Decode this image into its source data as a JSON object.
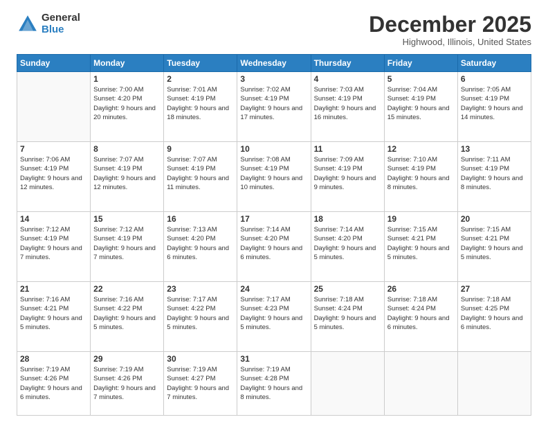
{
  "logo": {
    "general": "General",
    "blue": "Blue"
  },
  "header": {
    "month": "December 2025",
    "location": "Highwood, Illinois, United States"
  },
  "weekdays": [
    "Sunday",
    "Monday",
    "Tuesday",
    "Wednesday",
    "Thursday",
    "Friday",
    "Saturday"
  ],
  "weeks": [
    [
      {
        "day": "",
        "sunrise": "",
        "sunset": "",
        "daylight": ""
      },
      {
        "day": "1",
        "sunrise": "Sunrise: 7:00 AM",
        "sunset": "Sunset: 4:20 PM",
        "daylight": "Daylight: 9 hours and 20 minutes."
      },
      {
        "day": "2",
        "sunrise": "Sunrise: 7:01 AM",
        "sunset": "Sunset: 4:19 PM",
        "daylight": "Daylight: 9 hours and 18 minutes."
      },
      {
        "day": "3",
        "sunrise": "Sunrise: 7:02 AM",
        "sunset": "Sunset: 4:19 PM",
        "daylight": "Daylight: 9 hours and 17 minutes."
      },
      {
        "day": "4",
        "sunrise": "Sunrise: 7:03 AM",
        "sunset": "Sunset: 4:19 PM",
        "daylight": "Daylight: 9 hours and 16 minutes."
      },
      {
        "day": "5",
        "sunrise": "Sunrise: 7:04 AM",
        "sunset": "Sunset: 4:19 PM",
        "daylight": "Daylight: 9 hours and 15 minutes."
      },
      {
        "day": "6",
        "sunrise": "Sunrise: 7:05 AM",
        "sunset": "Sunset: 4:19 PM",
        "daylight": "Daylight: 9 hours and 14 minutes."
      }
    ],
    [
      {
        "day": "7",
        "sunrise": "Sunrise: 7:06 AM",
        "sunset": "Sunset: 4:19 PM",
        "daylight": "Daylight: 9 hours and 12 minutes."
      },
      {
        "day": "8",
        "sunrise": "Sunrise: 7:07 AM",
        "sunset": "Sunset: 4:19 PM",
        "daylight": "Daylight: 9 hours and 12 minutes."
      },
      {
        "day": "9",
        "sunrise": "Sunrise: 7:07 AM",
        "sunset": "Sunset: 4:19 PM",
        "daylight": "Daylight: 9 hours and 11 minutes."
      },
      {
        "day": "10",
        "sunrise": "Sunrise: 7:08 AM",
        "sunset": "Sunset: 4:19 PM",
        "daylight": "Daylight: 9 hours and 10 minutes."
      },
      {
        "day": "11",
        "sunrise": "Sunrise: 7:09 AM",
        "sunset": "Sunset: 4:19 PM",
        "daylight": "Daylight: 9 hours and 9 minutes."
      },
      {
        "day": "12",
        "sunrise": "Sunrise: 7:10 AM",
        "sunset": "Sunset: 4:19 PM",
        "daylight": "Daylight: 9 hours and 8 minutes."
      },
      {
        "day": "13",
        "sunrise": "Sunrise: 7:11 AM",
        "sunset": "Sunset: 4:19 PM",
        "daylight": "Daylight: 9 hours and 8 minutes."
      }
    ],
    [
      {
        "day": "14",
        "sunrise": "Sunrise: 7:12 AM",
        "sunset": "Sunset: 4:19 PM",
        "daylight": "Daylight: 9 hours and 7 minutes."
      },
      {
        "day": "15",
        "sunrise": "Sunrise: 7:12 AM",
        "sunset": "Sunset: 4:19 PM",
        "daylight": "Daylight: 9 hours and 7 minutes."
      },
      {
        "day": "16",
        "sunrise": "Sunrise: 7:13 AM",
        "sunset": "Sunset: 4:20 PM",
        "daylight": "Daylight: 9 hours and 6 minutes."
      },
      {
        "day": "17",
        "sunrise": "Sunrise: 7:14 AM",
        "sunset": "Sunset: 4:20 PM",
        "daylight": "Daylight: 9 hours and 6 minutes."
      },
      {
        "day": "18",
        "sunrise": "Sunrise: 7:14 AM",
        "sunset": "Sunset: 4:20 PM",
        "daylight": "Daylight: 9 hours and 5 minutes."
      },
      {
        "day": "19",
        "sunrise": "Sunrise: 7:15 AM",
        "sunset": "Sunset: 4:21 PM",
        "daylight": "Daylight: 9 hours and 5 minutes."
      },
      {
        "day": "20",
        "sunrise": "Sunrise: 7:15 AM",
        "sunset": "Sunset: 4:21 PM",
        "daylight": "Daylight: 9 hours and 5 minutes."
      }
    ],
    [
      {
        "day": "21",
        "sunrise": "Sunrise: 7:16 AM",
        "sunset": "Sunset: 4:21 PM",
        "daylight": "Daylight: 9 hours and 5 minutes."
      },
      {
        "day": "22",
        "sunrise": "Sunrise: 7:16 AM",
        "sunset": "Sunset: 4:22 PM",
        "daylight": "Daylight: 9 hours and 5 minutes."
      },
      {
        "day": "23",
        "sunrise": "Sunrise: 7:17 AM",
        "sunset": "Sunset: 4:22 PM",
        "daylight": "Daylight: 9 hours and 5 minutes."
      },
      {
        "day": "24",
        "sunrise": "Sunrise: 7:17 AM",
        "sunset": "Sunset: 4:23 PM",
        "daylight": "Daylight: 9 hours and 5 minutes."
      },
      {
        "day": "25",
        "sunrise": "Sunrise: 7:18 AM",
        "sunset": "Sunset: 4:24 PM",
        "daylight": "Daylight: 9 hours and 5 minutes."
      },
      {
        "day": "26",
        "sunrise": "Sunrise: 7:18 AM",
        "sunset": "Sunset: 4:24 PM",
        "daylight": "Daylight: 9 hours and 6 minutes."
      },
      {
        "day": "27",
        "sunrise": "Sunrise: 7:18 AM",
        "sunset": "Sunset: 4:25 PM",
        "daylight": "Daylight: 9 hours and 6 minutes."
      }
    ],
    [
      {
        "day": "28",
        "sunrise": "Sunrise: 7:19 AM",
        "sunset": "Sunset: 4:26 PM",
        "daylight": "Daylight: 9 hours and 6 minutes."
      },
      {
        "day": "29",
        "sunrise": "Sunrise: 7:19 AM",
        "sunset": "Sunset: 4:26 PM",
        "daylight": "Daylight: 9 hours and 7 minutes."
      },
      {
        "day": "30",
        "sunrise": "Sunrise: 7:19 AM",
        "sunset": "Sunset: 4:27 PM",
        "daylight": "Daylight: 9 hours and 7 minutes."
      },
      {
        "day": "31",
        "sunrise": "Sunrise: 7:19 AM",
        "sunset": "Sunset: 4:28 PM",
        "daylight": "Daylight: 9 hours and 8 minutes."
      },
      {
        "day": "",
        "sunrise": "",
        "sunset": "",
        "daylight": ""
      },
      {
        "day": "",
        "sunrise": "",
        "sunset": "",
        "daylight": ""
      },
      {
        "day": "",
        "sunrise": "",
        "sunset": "",
        "daylight": ""
      }
    ]
  ]
}
